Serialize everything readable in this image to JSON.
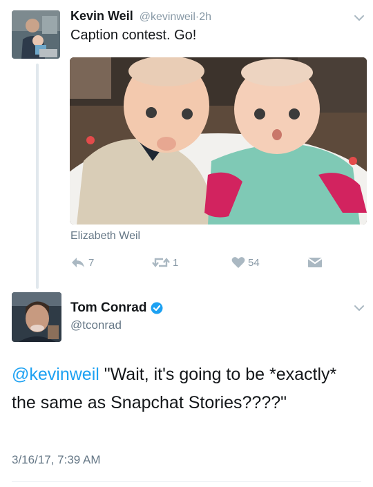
{
  "tweet1": {
    "name": "Kevin Weil",
    "handle": "@kevinweil",
    "separator": "·",
    "time": "2h",
    "text": "Caption contest. Go!",
    "photo_credit": "Elizabeth Weil",
    "actions": {
      "reply_count": "7",
      "retweet_count": "1",
      "like_count": "54"
    }
  },
  "tweet2": {
    "name": "Tom Conrad",
    "handle": "@tconrad",
    "mention": "@kevinweil",
    "text": " \"Wait, it's going to be *exactly* the same as Snapchat Stories????\"",
    "timestamp": "3/16/17, 7:39 AM"
  },
  "colors": {
    "accent": "#1da1f2",
    "muted": "#8899a6",
    "text": "#14171a",
    "verified": "#1da1f2"
  },
  "icons": [
    "reply-icon",
    "retweet-icon",
    "heart-icon",
    "direct-message-icon",
    "chevron-down-icon",
    "verified-badge-icon"
  ]
}
